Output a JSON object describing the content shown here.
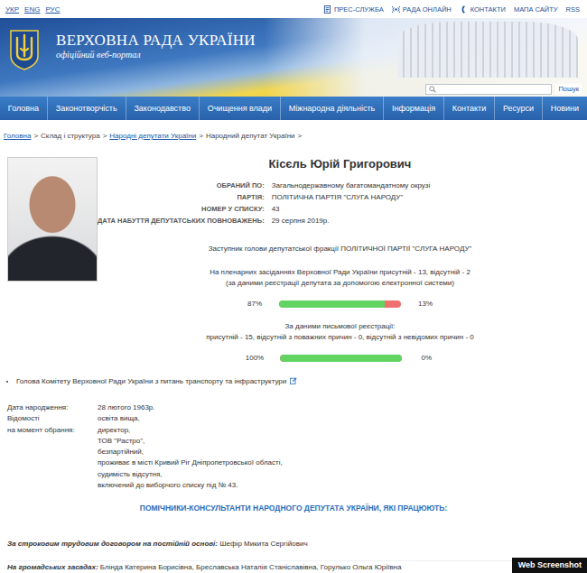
{
  "top_bar": {
    "languages": [
      "УКР",
      "ENG",
      "РУС"
    ],
    "links": [
      {
        "label": "ПРЕС-СЛУЖБА",
        "kind": "press"
      },
      {
        "label": "РАДА ОНЛАЙН",
        "kind": "broadcast"
      },
      {
        "label": "КОНТАКТИ",
        "kind": "phone"
      },
      {
        "label": "МАПА САЙТУ",
        "kind": "plain"
      },
      {
        "label": "RSS",
        "kind": "plain"
      }
    ]
  },
  "header": {
    "title": "ВЕРХОВНА РАДА УКРАЇНИ",
    "subtitle": "офіційний веб-портал",
    "search": {
      "placeholder": "",
      "button": "Пошук"
    }
  },
  "nav": [
    "Головна",
    "Законотворчість",
    "Законодавство",
    "Очищення влади",
    "Міжнародна діяльність",
    "Інформація",
    "Контакти",
    "Ресурси",
    "Новини"
  ],
  "breadcrumb": {
    "separator": ">",
    "items": [
      {
        "label": "Головна",
        "kind": "link"
      },
      {
        "label": "Склад і структура",
        "kind": "plain"
      },
      {
        "label": "Народні депутати України",
        "kind": "link"
      },
      {
        "label": "Народний депутат України",
        "kind": "plain"
      }
    ]
  },
  "deputy": {
    "name": "Кісєль Юрій Григорович",
    "fields": [
      {
        "label": "ОБРАНИЙ ПО:",
        "value": "Загальнодержавному багатомандатному окрузі"
      },
      {
        "label": "ПАРТІЯ:",
        "value": "ПОЛІТИЧНА ПАРТІЯ \"СЛУГА НАРОДУ\""
      },
      {
        "label": "НОМЕР У СПИСКУ:",
        "value": "43"
      },
      {
        "label": "ДАТА НАБУТТЯ ДЕПУТАТСЬКИХ ПОВНОВАЖЕНЬ:",
        "value": "29 серпня 2019р."
      }
    ],
    "role": "Заступник голови депутатської фракції ПОЛІТИЧНОЇ ПАРТІЇ \"СЛУГА НАРОДУ\"",
    "attendance": [
      {
        "lines": [
          "На пленарних засіданнях Верховної Ради України присутній - 13, відсутній - 2",
          "(за даними реєстрації депутата за допомогою електронної системи)"
        ],
        "present": "87%",
        "absent": "13%",
        "level": 0.87
      },
      {
        "lines": [
          "За даними письмової реєстрації:",
          "присутній - 15, відсутній з поважних причин - 0, відсутній з невідомих причин - 0"
        ],
        "present": "100%",
        "absent": "0%",
        "level": 1.0
      }
    ],
    "committees": [
      "Голова Комітету Верховної Ради України з питань транспорту та інфраструктури"
    ],
    "details": [
      {
        "label": [
          "Дата народження:"
        ],
        "values": [
          "28 лютого 1963р."
        ]
      },
      {
        "label": [
          "Відомості",
          "на момент обрання:"
        ],
        "values": [
          "освіта вища,",
          "директор,",
          "ТОВ \"Растро\",",
          "безпартійний,",
          "проживає в місті Кривий Ріг Дніпропетровської області,",
          "судимість відсутня,",
          "включений до виборчого списку під № 43."
        ]
      }
    ]
  },
  "assistants": {
    "heading": "ПОМІЧНИКИ-КОНСУЛЬТАНТИ НАРОДНОГО ДЕПУТАТА УКРАЇНИ, ЯКІ ПРАЦЮЮТЬ:",
    "groups": [
      {
        "label": "За строковим трудовим договором на постійній основі:",
        "names": "Шефір Микита Сергійович"
      },
      {
        "label": "На громадських засадах:",
        "names": "Бліндa Катерина Борисівна, Бреславська Наталія Станіславівна, Горулько Ольга Юріївна"
      }
    ]
  },
  "badge": "Web Screenshot"
}
